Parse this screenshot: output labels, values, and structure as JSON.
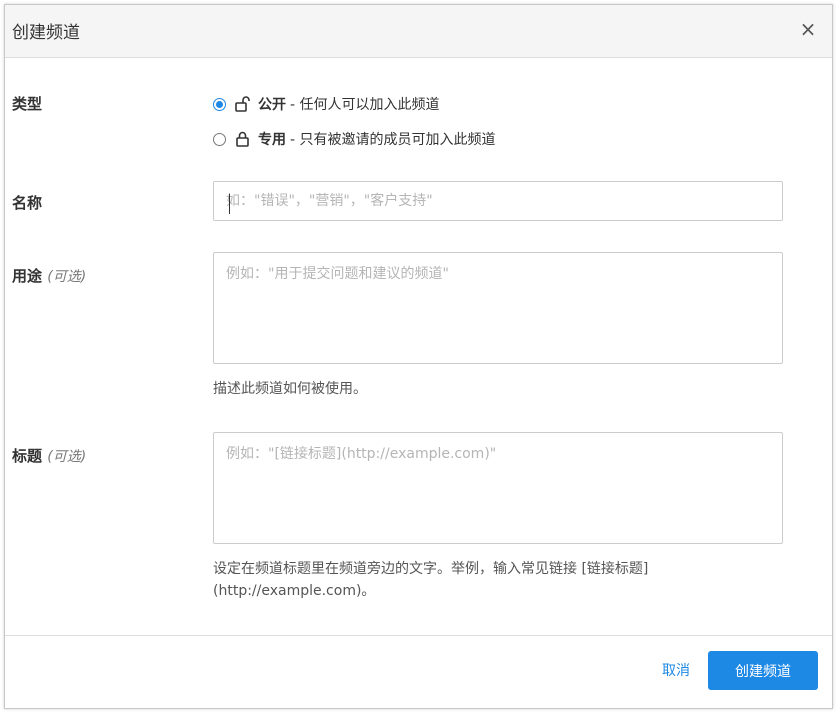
{
  "dialog": {
    "title": "创建频道",
    "close_label": "×"
  },
  "type_field": {
    "label": "类型",
    "options": [
      {
        "strong": "公开",
        "desc": " - 任何人可以加入此频道",
        "checked": true,
        "icon": "unlock-icon"
      },
      {
        "strong": "专用",
        "desc": " - 只有被邀请的成员可加入此频道",
        "checked": false,
        "icon": "lock-icon"
      }
    ]
  },
  "name_field": {
    "label": "名称",
    "value": "",
    "placeholder": "如：\"错误\"，\"营销\"，\"客户支持\""
  },
  "purpose_field": {
    "label": "用途",
    "optional": "(可选)",
    "value": "",
    "placeholder": "例如：\"用于提交问题和建议的频道\"",
    "help": "描述此频道如何被使用。"
  },
  "header_field": {
    "label": "标题",
    "optional": "(可选)",
    "value": "",
    "placeholder": "例如：\"[链接标题](http://example.com)\"",
    "help": "设定在频道标题里在频道旁边的文字。举例，输入常见链接 [链接标题](http://example.com)。"
  },
  "footer": {
    "cancel_label": "取消",
    "submit_label": "创建频道"
  },
  "colors": {
    "accent": "#1e88e5",
    "header_bg": "#f5f5f5",
    "border": "#cccccc"
  }
}
